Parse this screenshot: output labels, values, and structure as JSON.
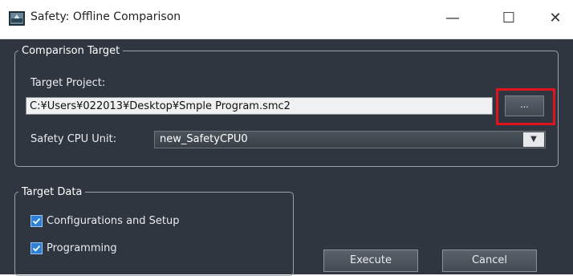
{
  "window": {
    "title": "Safety: Offline Comparison",
    "minimize_glyph": "—",
    "maximize_glyph": "☐",
    "close_glyph": "✕"
  },
  "comparison_target": {
    "legend": "Comparison Target",
    "project_label": "Target Project:",
    "project_value": "C:¥Users¥022013¥Desktop¥Smple Program.smc2",
    "browse_label": "...",
    "cpu_label": "Safety CPU Unit:",
    "cpu_value": "new_SafetyCPU0"
  },
  "target_data": {
    "legend": "Target Data",
    "items": [
      {
        "label": "Configurations and Setup",
        "checked": true
      },
      {
        "label": "Programming",
        "checked": true
      }
    ]
  },
  "buttons": {
    "execute": "Execute",
    "cancel": "Cancel"
  },
  "colors": {
    "background": "#2f3640",
    "highlight": "#e0141e",
    "checkbox": "#2e7fd6"
  }
}
